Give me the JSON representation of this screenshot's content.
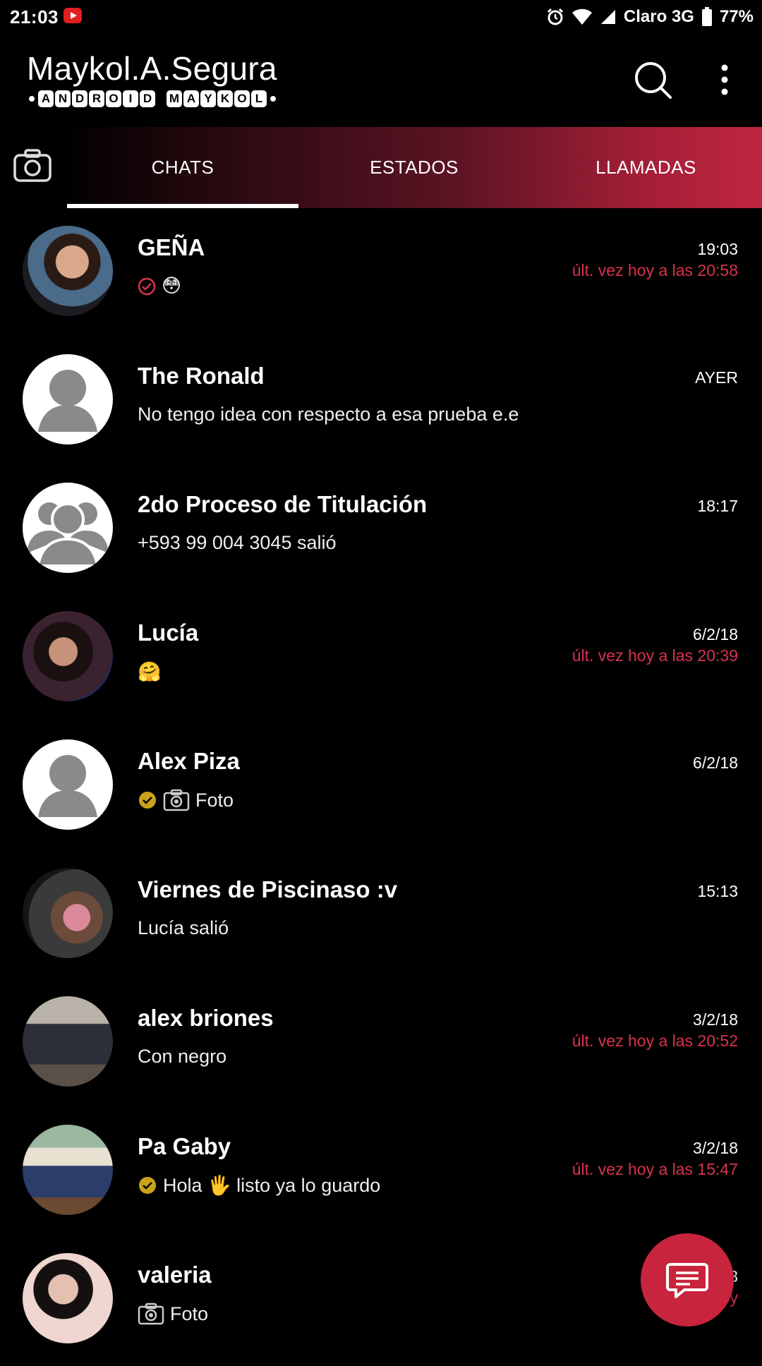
{
  "status_bar": {
    "time": "21:03",
    "carrier": "Claro 3G",
    "battery": "77%"
  },
  "app": {
    "title": "Maykol.A.Segura",
    "tagline_word1": [
      "A",
      "N",
      "D",
      "R",
      "O",
      "I",
      "D"
    ],
    "tagline_word2": [
      "M",
      "A",
      "Y",
      "K",
      "O",
      "L"
    ]
  },
  "tabs": {
    "chats": "CHATS",
    "status": "ESTADOS",
    "calls": "LLAMADAS"
  },
  "chats": [
    {
      "name": "GEÑA",
      "time": "19:03",
      "seen": "últ. vez hoy a las 20:58",
      "preview": "😳",
      "tick": "red"
    },
    {
      "name": "The Ronald",
      "time": "AYER",
      "seen": "",
      "preview": "No tengo idea con respecto a esa prueba e.e",
      "tick": ""
    },
    {
      "name": "2do Proceso de Titulación",
      "time": "18:17",
      "seen": "",
      "preview": "+593 99 004 3045 salió",
      "tick": ""
    },
    {
      "name": "Lucía",
      "time": "6/2/18",
      "seen": "últ. vez hoy a las 20:39",
      "preview": "🤗",
      "tick": ""
    },
    {
      "name": "Alex Piza",
      "time": "6/2/18",
      "seen": "",
      "preview": "Foto",
      "tick": "gold",
      "camera": true
    },
    {
      "name": "Viernes de Piscinaso :v",
      "time": "15:13",
      "seen": "",
      "preview": "Lucía salió",
      "tick": ""
    },
    {
      "name": "alex briones",
      "time": "3/2/18",
      "seen": "últ. vez hoy a las 20:52",
      "preview": "Con negro",
      "tick": ""
    },
    {
      "name": "Pa Gaby",
      "time": "3/2/18",
      "seen": "últ. vez hoy a las 15:47",
      "preview": "Hola 🖐 listo ya lo guardo",
      "tick": "gold"
    },
    {
      "name": "valeria",
      "time": "3",
      "seen": "últ. vez hoy",
      "preview": "Foto",
      "tick": "",
      "camera": true
    }
  ],
  "colors": {
    "accent": "#c8243d",
    "seen_text": "#d8324d",
    "gold_tick": "#c9a21a"
  }
}
